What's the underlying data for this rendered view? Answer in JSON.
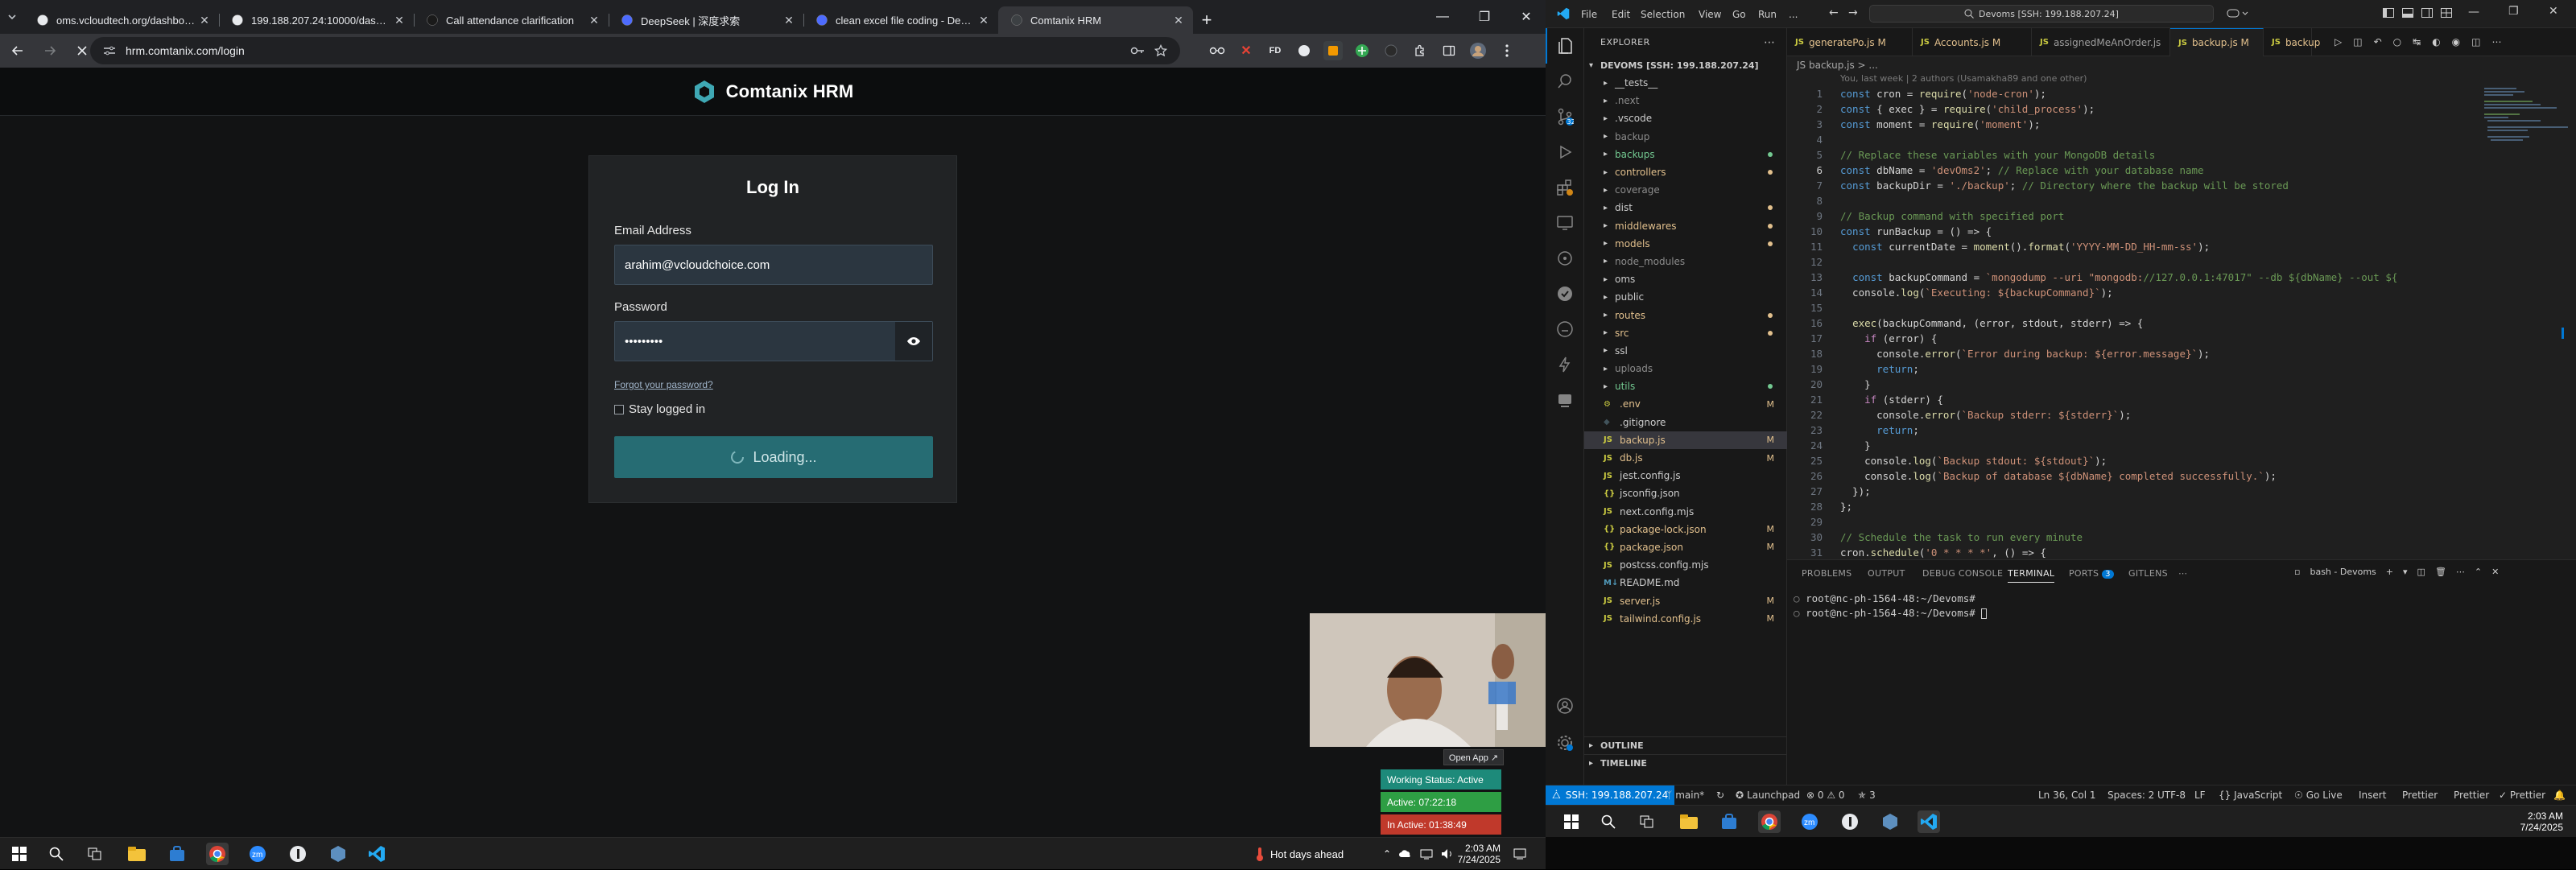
{
  "browser": {
    "tabs": [
      {
        "title": "oms.vcloudtech.org/dashboard",
        "active": false
      },
      {
        "title": "199.188.207.24:10000/dashboard",
        "active": false
      },
      {
        "title": "Call attendance clarification",
        "active": false
      },
      {
        "title": "DeepSeek | 深度求索",
        "active": false
      },
      {
        "title": "clean excel file coding - DeepSeek",
        "active": false
      },
      {
        "title": "Comtanix HRM",
        "active": true
      }
    ],
    "url": "hrm.comtanix.com/login",
    "extension_label": "FD"
  },
  "hrm": {
    "brand": "Comtanix HRM",
    "login_title": "Log In",
    "email_label": "Email Address",
    "email_value": "arahim@vcloudchoice.com",
    "password_label": "Password",
    "password_value": "•••••••••",
    "forgot_link": "Forgot your password?",
    "stay_logged_in": "Stay logged in",
    "login_button": "Loading..."
  },
  "overlay": {
    "open_app": "Open App ↗",
    "working_status": "Working Status: Active",
    "active_time": "Active: 07:22:18",
    "inactive_time": "In Active: 01:38:49"
  },
  "left_taskbar": {
    "weather": "Hot days ahead",
    "time": "2:03 AM",
    "date": "7/24/2025"
  },
  "vscode": {
    "menus": [
      "File",
      "Edit",
      "Selection",
      "View",
      "Go",
      "Run",
      "..."
    ],
    "command_center": "Devoms [SSH: 199.188.207.24]",
    "explorer_title": "EXPLORER",
    "root_title": "DEVOMS [SSH: 199.188.207.24]",
    "tree": [
      {
        "name": "__tests__",
        "type": "folder",
        "color": "#cccccc",
        "badge": ""
      },
      {
        "name": ".next",
        "type": "folder",
        "color": "#8c8c8c",
        "badge": ""
      },
      {
        "name": ".vscode",
        "type": "folder",
        "color": "#cccccc",
        "badge": ""
      },
      {
        "name": "backup",
        "type": "folder",
        "color": "#8c8c8c",
        "badge": ""
      },
      {
        "name": "backups",
        "type": "folder",
        "color": "#73c991",
        "badge": "dot"
      },
      {
        "name": "controllers",
        "type": "folder",
        "color": "#e2c08d",
        "badge": "dot"
      },
      {
        "name": "coverage",
        "type": "folder",
        "color": "#8c8c8c",
        "badge": ""
      },
      {
        "name": "dist",
        "type": "folder",
        "color": "#cccccc",
        "badge": "dot"
      },
      {
        "name": "middlewares",
        "type": "folder",
        "color": "#e2c08d",
        "badge": "dot"
      },
      {
        "name": "models",
        "type": "folder",
        "color": "#e2c08d",
        "badge": "dot"
      },
      {
        "name": "node_modules",
        "type": "folder",
        "color": "#8c8c8c",
        "badge": ""
      },
      {
        "name": "oms",
        "type": "folder",
        "color": "#cccccc",
        "badge": ""
      },
      {
        "name": "public",
        "type": "folder",
        "color": "#cccccc",
        "badge": ""
      },
      {
        "name": "routes",
        "type": "folder",
        "color": "#e2c08d",
        "badge": "dot"
      },
      {
        "name": "src",
        "type": "folder",
        "color": "#e2c08d",
        "badge": "dot"
      },
      {
        "name": "ssl",
        "type": "folder",
        "color": "#cccccc",
        "badge": ""
      },
      {
        "name": "uploads",
        "type": "folder",
        "color": "#8c8c8c",
        "badge": ""
      },
      {
        "name": "utils",
        "type": "folder",
        "color": "#73c991",
        "badge": "dot"
      },
      {
        "name": ".env",
        "type": "env",
        "color": "#e2c08d",
        "badge": "M"
      },
      {
        "name": ".gitignore",
        "type": "git",
        "color": "#cccccc",
        "badge": ""
      },
      {
        "name": "backup.js",
        "type": "js",
        "color": "#e2c08d",
        "badge": "M",
        "selected": true
      },
      {
        "name": "db.js",
        "type": "js",
        "color": "#e2c08d",
        "badge": "M"
      },
      {
        "name": "jest.config.js",
        "type": "js",
        "color": "#cccccc",
        "badge": ""
      },
      {
        "name": "jsconfig.json",
        "type": "json",
        "color": "#cccccc",
        "badge": ""
      },
      {
        "name": "next.config.mjs",
        "type": "js",
        "color": "#cccccc",
        "badge": ""
      },
      {
        "name": "package-lock.json",
        "type": "json",
        "color": "#e2c08d",
        "badge": "M"
      },
      {
        "name": "package.json",
        "type": "json",
        "color": "#e2c08d",
        "badge": "M"
      },
      {
        "name": "postcss.config.mjs",
        "type": "js",
        "color": "#cccccc",
        "badge": ""
      },
      {
        "name": "README.md",
        "type": "md",
        "color": "#cccccc",
        "badge": ""
      },
      {
        "name": "server.js",
        "type": "js",
        "color": "#e2c08d",
        "badge": "M"
      },
      {
        "name": "tailwind.config.js",
        "type": "js",
        "color": "#e2c08d",
        "badge": "M"
      }
    ],
    "outline": "OUTLINE",
    "timeline": "TIMELINE",
    "editor_tabs": [
      {
        "name": "generatePo.js M",
        "active": false
      },
      {
        "name": "Accounts.js M",
        "active": false
      },
      {
        "name": "assignedMeAnOrder.js",
        "active": false
      },
      {
        "name": "backup.js M",
        "active": true
      },
      {
        "name": "backup",
        "active": false
      }
    ],
    "breadcrumb": "JS backup.js > ...",
    "blame": "You, last week | 2 authors (Usamakha89 and one other)",
    "panel_tabs": [
      "PROBLEMS",
      "OUTPUT",
      "DEBUG CONSOLE",
      "TERMINAL",
      "PORTS",
      "GITLENS"
    ],
    "ports_badge": "3",
    "terminal_name": "bash - Devoms",
    "terminal_lines": [
      "root@nc-ph-1564-48:~/Devoms#",
      "root@nc-ph-1564-48:~/Devoms# "
    ],
    "status": {
      "remote": "SSH: 199.188.207.24",
      "branch": "main*",
      "launchpad": "Launchpad",
      "problems": "⊗ 0 ⚠ 0",
      "ports": "3",
      "position": "Ln 36, Col 1",
      "spaces": "Spaces: 2",
      "encoding": "UTF-8",
      "eol": "LF",
      "lang": "{} JavaScript",
      "golive": "Go Live",
      "insert": "Insert",
      "prettier1": "Prettier",
      "prettier2": "Prettier",
      "prettier3": "✓ Prettier"
    },
    "taskbar_time": "2:03 AM",
    "taskbar_date": "7/24/2025"
  },
  "code_lines": [
    "const cron = require('node-cron');",
    "const { exec } = require('child_process');",
    "const moment = require('moment');",
    "",
    "// Replace these variables with your MongoDB details",
    "const dbName = 'devOms2'; // Replace with your database name",
    "const backupDir = './backup'; // Directory where the backup will be stored",
    "",
    "// Backup command with specified port",
    "const runBackup = () => {",
    "  const currentDate = moment().format('YYYY-MM-DD_HH-mm-ss');",
    "",
    "  const backupCommand = `mongodump --uri \"mongodb://127.0.0.1:47017\" --db ${dbName} --out ${",
    "  console.log(`Executing: ${backupCommand}`);",
    "",
    "  exec(backupCommand, (error, stdout, stderr) => {",
    "    if (error) {",
    "      console.error(`Error during backup: ${error.message}`);",
    "      return;",
    "    }",
    "    if (stderr) {",
    "      console.error(`Backup stderr: ${stderr}`);",
    "      return;",
    "    }",
    "    console.log(`Backup stdout: ${stdout}`);",
    "    console.log(`Backup of database ${dbName} completed successfully.`);",
    "  });",
    "};",
    "",
    "// Schedule the task to run every minute",
    "cron.schedule('0 * * * *', () => {"
  ],
  "colors": {
    "accent": "#0078d4",
    "login_button": "#266c73",
    "status_active": "#1d8a7a",
    "status_green": "#2e9e44",
    "status_red": "#c0392b",
    "modified": "#e2c08d",
    "untracked": "#73c991"
  }
}
